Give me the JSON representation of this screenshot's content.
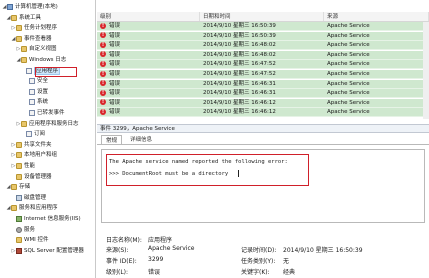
{
  "tree": {
    "items": [
      {
        "label": "计算机管理(本地)",
        "icon": "computer-icon",
        "exp": "◢"
      },
      {
        "label": "系统工具",
        "icon": "tools-icon",
        "exp": "◢"
      },
      {
        "label": "任务计划程序",
        "icon": "task-icon",
        "exp": "▷"
      },
      {
        "label": "事件查看器",
        "icon": "event-viewer-icon",
        "exp": "◢"
      },
      {
        "label": "自定义视图",
        "icon": "folder-icon",
        "exp": "▷"
      },
      {
        "label": "Windows 日志",
        "icon": "folder-icon",
        "exp": "◢"
      },
      {
        "label": "应用程序",
        "icon": "log-icon",
        "exp": ""
      },
      {
        "label": "安全",
        "icon": "log-icon",
        "exp": ""
      },
      {
        "label": "设置",
        "icon": "log-icon",
        "exp": ""
      },
      {
        "label": "系统",
        "icon": "log-icon",
        "exp": ""
      },
      {
        "label": "已转发事件",
        "icon": "log-icon",
        "exp": ""
      },
      {
        "label": "应用程序和服务日志",
        "icon": "folder-icon",
        "exp": "▷"
      },
      {
        "label": "订阅",
        "icon": "log-icon",
        "exp": ""
      },
      {
        "label": "共享文件夹",
        "icon": "shared-folder-icon",
        "exp": "▷"
      },
      {
        "label": "本地用户和组",
        "icon": "users-icon",
        "exp": "▷"
      },
      {
        "label": "性能",
        "icon": "performance-icon",
        "exp": "▷"
      },
      {
        "label": "设备管理器",
        "icon": "device-manager-icon",
        "exp": ""
      },
      {
        "label": "存储",
        "icon": "storage-icon",
        "exp": "◢"
      },
      {
        "label": "磁盘管理",
        "icon": "disk-icon",
        "exp": ""
      },
      {
        "label": "服务和应用程序",
        "icon": "services-icon",
        "exp": "◢"
      },
      {
        "label": "Internet 信息服务(IIS)",
        "icon": "iis-icon",
        "exp": ""
      },
      {
        "label": "服务",
        "icon": "gear-icon",
        "exp": ""
      },
      {
        "label": "WMI 控件",
        "icon": "wmi-icon",
        "exp": ""
      },
      {
        "label": "SQL Server 配置管理器",
        "icon": "sql-icon",
        "exp": "▷"
      }
    ]
  },
  "grid": {
    "headers": [
      "级别",
      "日期和时间",
      "来源"
    ],
    "rows": [
      {
        "level": "错误",
        "datetime": "2014/9/10 星期三 16:50:39",
        "source": "Apache Service"
      },
      {
        "level": "错误",
        "datetime": "2014/9/10 星期三 16:50:39",
        "source": "Apache Service"
      },
      {
        "level": "错误",
        "datetime": "2014/9/10 星期三 16:48:02",
        "source": "Apache Service"
      },
      {
        "level": "错误",
        "datetime": "2014/9/10 星期三 16:48:02",
        "source": "Apache Service"
      },
      {
        "level": "错误",
        "datetime": "2014/9/10 星期三 16:47:52",
        "source": "Apache Service"
      },
      {
        "level": "错误",
        "datetime": "2014/9/10 星期三 16:47:52",
        "source": "Apache Service"
      },
      {
        "level": "错误",
        "datetime": "2014/9/10 星期三 16:46:31",
        "source": "Apache Service"
      },
      {
        "level": "错误",
        "datetime": "2014/9/10 星期三 16:46:31",
        "source": "Apache Service"
      },
      {
        "level": "错误",
        "datetime": "2014/9/10 星期三 16:46:12",
        "source": "Apache Service"
      },
      {
        "level": "错误",
        "datetime": "2014/9/10 星期三 16:46:12",
        "source": "Apache Service"
      }
    ]
  },
  "detail": {
    "title": "事件 3299，Apache Service",
    "tabs": [
      "常规",
      "详细信息"
    ],
    "message_line1": "The Apache service named  reported the following error:",
    "message_line2": ">>> DocumentRoot must be a directory"
  },
  "props": {
    "log_name_label": "日志名称(M):",
    "log_name_value": "应用程序",
    "source_label": "来源(S):",
    "source_value": "Apache Service",
    "logged_label": "记录时间(D):",
    "logged_value": "2014/9/10 星期三 16:50:39",
    "event_id_label": "事件 ID(E):",
    "event_id_value": "3299",
    "category_label": "任务类别(Y):",
    "category_value": "无",
    "level_label": "级别(L):",
    "level_value": "错误",
    "keywords_label": "关键字(K):",
    "keywords_value": "经典"
  },
  "colors": {
    "row_bg": "#cfe8cf",
    "error_icon": "#d9252a",
    "highlight_box": "#d0202a"
  }
}
